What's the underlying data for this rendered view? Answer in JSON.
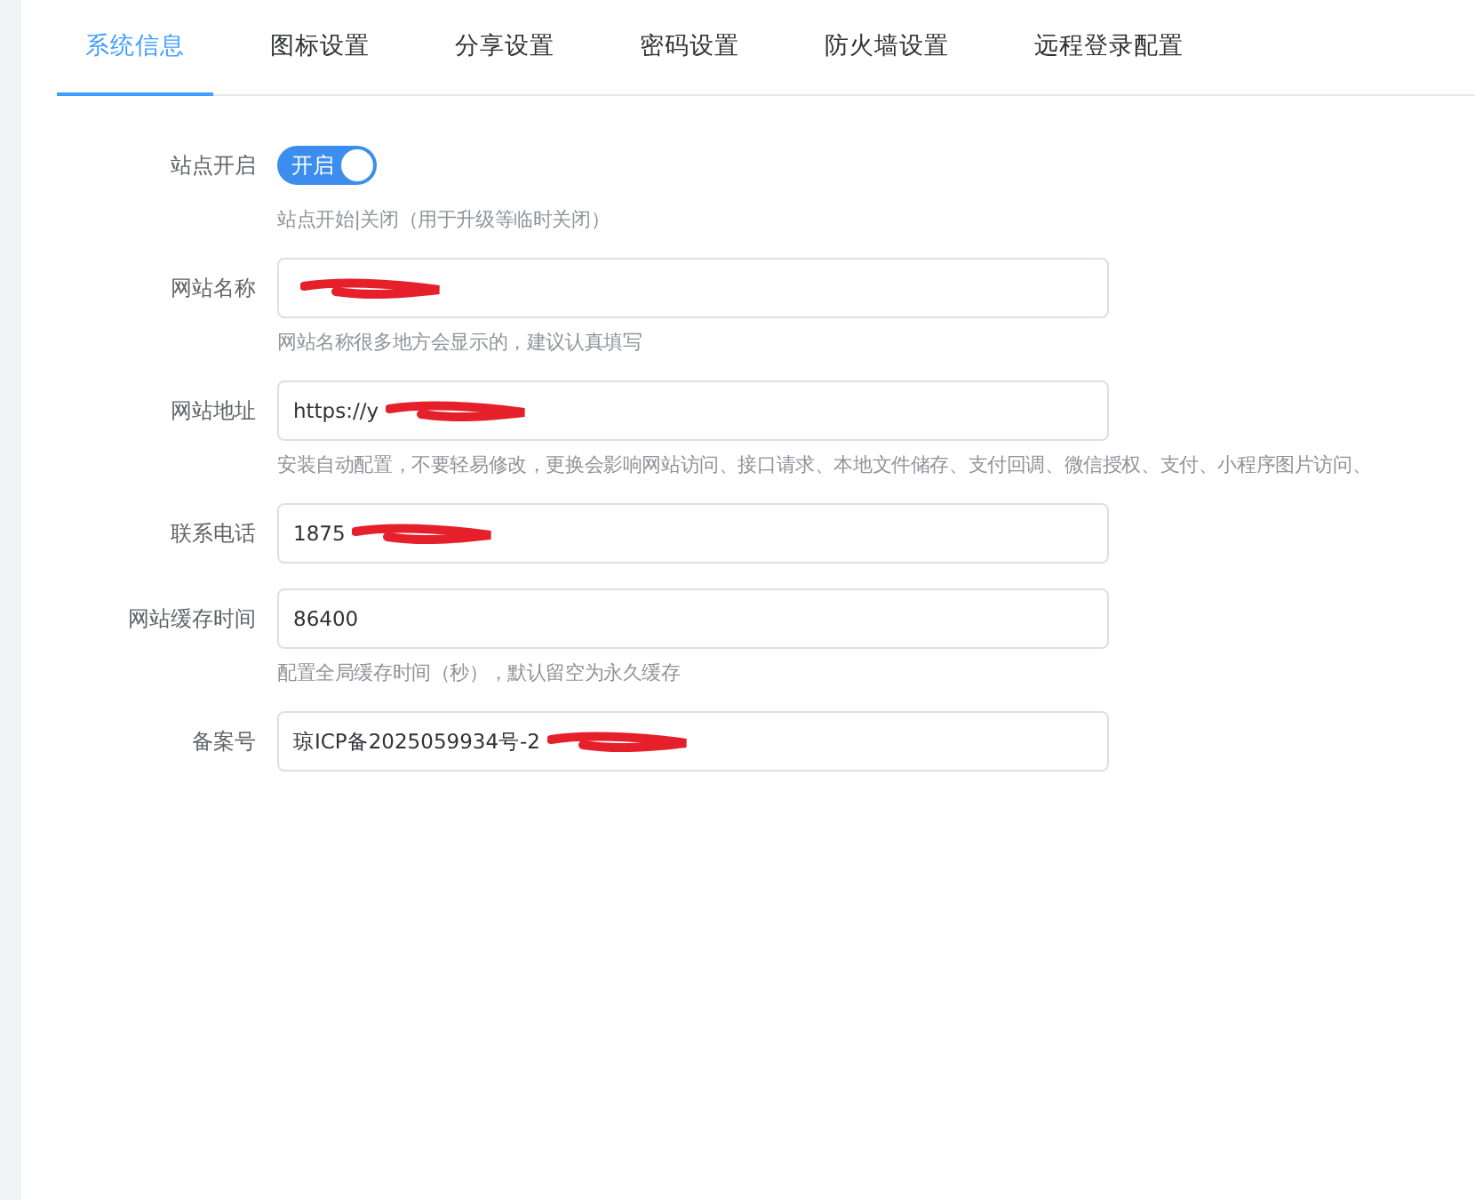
{
  "tabs": [
    {
      "label": "系统信息",
      "selected": true
    },
    {
      "label": "图标设置",
      "selected": false
    },
    {
      "label": "分享设置",
      "selected": false
    },
    {
      "label": "密码设置",
      "selected": false
    },
    {
      "label": "防火墙设置",
      "selected": false
    },
    {
      "label": "远程登录配置",
      "selected": false
    }
  ],
  "fields": [
    {
      "kind": "switch",
      "label": "站点开启",
      "on": true,
      "switch_text": "开启",
      "hint": "站点开始|关闭（用于升级等临时关闭）"
    },
    {
      "kind": "text",
      "label": "网站名称",
      "redacted": true,
      "hint": "网站名称很多地方会显示的，建议认真填写"
    },
    {
      "kind": "text",
      "label": "网站地址",
      "value": "https://y",
      "redacted": true,
      "hint": "安装自动配置，不要轻易修改，更换会影响网站访问、接口请求、本地文件储存、支付回调、微信授权、支付、小程序图片访问、"
    },
    {
      "kind": "text",
      "label": "联系电话",
      "value": "1875",
      "redacted": true
    },
    {
      "kind": "text",
      "label": "网站缓存时间",
      "value": "86400",
      "hint": "配置全局缓存时间（秒），默认留空为永久缓存"
    },
    {
      "kind": "text",
      "label": "备案号",
      "value": "琼ICP备2025059934号-2",
      "redacted": true
    }
  ]
}
